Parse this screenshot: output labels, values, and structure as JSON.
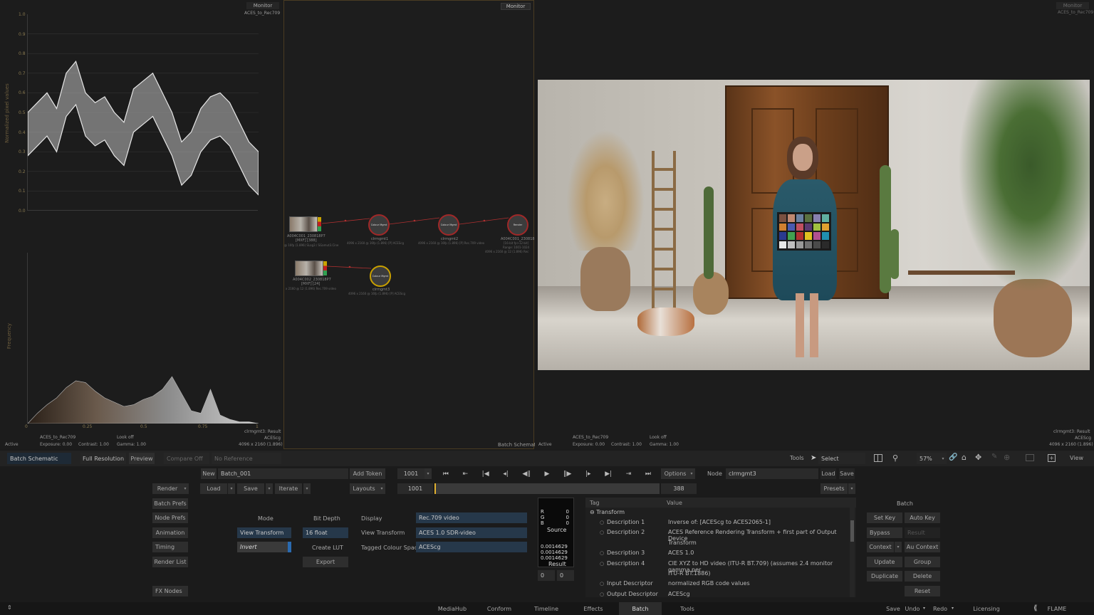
{
  "scopes": {
    "monitor_button": "Monitor",
    "view_transform": "ACES_to_Rec709",
    "waveform": {
      "ylabel": "Normalized pixel values",
      "yticks": [
        "1.0",
        "0.9",
        "0.8",
        "0.7",
        "0.6",
        "0.5",
        "0.4",
        "0.3",
        "0.2",
        "0.1",
        "0.0"
      ]
    },
    "histogram": {
      "ylabel": "Frequency",
      "xticks": [
        "0",
        "0.25",
        "0.5",
        "0.75",
        "1"
      ]
    },
    "footer": {
      "status": "Active",
      "transform": "ACES_to_Rec709",
      "look": "Look off",
      "exposure": "Exposure: 0.00",
      "contrast": "Contrast: 1.00",
      "gamma": "Gamma: 1.00",
      "node": "clrmgmt3: Result",
      "space": "ACEScg",
      "resolution": "4096 x 2160 (1.896)"
    }
  },
  "schematic": {
    "monitor_button": "Monitor",
    "footer_label": "Batch Schematic",
    "nodes": [
      {
        "name": "A004C001_230818P7",
        "sub1": "[MXF] [388]",
        "sub2": "@ 16fp (1.896) SLog3 / SGamut3.Cine"
      },
      {
        "name": "clrmgmt1",
        "sub": "4096 x 2160 @ 16fp (1.896) [P] ACEScg"
      },
      {
        "name": "clrmgmt2",
        "sub": "4096 x 2160 @ 16fp (1.896) [P] Rec.709 video"
      },
      {
        "name": "A004C001_230818P",
        "sub1": "[16-bit fp>12-bit]",
        "sub2": "Range: 1001-1024",
        "sub3": "4096 x 2160 @ 12 (1.896) Rec"
      },
      {
        "name": "A004C002_230818P7",
        "sub1": "[MXF] [24]",
        "sub2": "x 2160 @ 12 (1.896) Rec.709 video"
      },
      {
        "name": "clrmgmt3",
        "sub": "4096 x 2160 @ 16fp (1.896) [P] ACEScg"
      }
    ],
    "node_icon_labels": {
      "colour_mgmt": "Colour Mgmt",
      "render": "Render"
    }
  },
  "viewer": {
    "monitor_button": "Monitor",
    "view_transform": "ACES_to_Rec709",
    "footer": {
      "status": "Active",
      "transform": "ACES_to_Rec709",
      "look": "Look off",
      "exposure": "Exposure: 0.00",
      "contrast": "Contrast: 1.00",
      "gamma": "Gamma: 1.00",
      "node": "clrmgmt3: Result",
      "space": "ACEScg",
      "resolution": "4096 x 2160 (1.896)"
    }
  },
  "viewbar": {
    "batch_schematic": "Batch Schematic",
    "full_resolution": "Full Resolution",
    "preview": "Preview",
    "compare_off": "Compare Off",
    "no_reference": "No Reference",
    "tools": "Tools",
    "select": "Select",
    "zoom": "57%",
    "view": "View"
  },
  "batch_controls": {
    "new": "New",
    "batch_name": "Batch_001",
    "add_token": "Add Token",
    "frame": "1001",
    "options": "Options",
    "node_label": "Node",
    "node_name": "clrmgmt3",
    "load": "Load",
    "save": "Save",
    "render": "Render",
    "load2": "Load",
    "save2": "Save",
    "iterate": "Iterate",
    "layouts": "Layouts",
    "range_start": "1001",
    "range_end": "388",
    "presets": "Presets",
    "batch_prefs": "Batch Prefs",
    "node_prefs": "Node Prefs",
    "animation": "Animation",
    "timing": "Timing",
    "render_list": "Render List",
    "fx_nodes": "FX Nodes"
  },
  "colour_mgmt": {
    "mode_label": "Mode",
    "mode_value": "View Transform",
    "invert": "Invert",
    "bit_depth_label": "Bit Depth",
    "bit_depth_value": "16 float",
    "create_lut": "Create LUT",
    "export": "Export",
    "display_label": "Display",
    "display_value": "Rec.709 video",
    "view_transform_label": "View Transform",
    "view_transform_value": "ACES 1.0 SDR-video",
    "tagged_label": "Tagged Colour Space",
    "tagged_value": "ACEScg"
  },
  "picker": {
    "r": "R",
    "g": "G",
    "b": "B",
    "src_r": "0",
    "src_g": "0",
    "src_b": "0",
    "source": "Source",
    "res_r": "0.0014629",
    "res_g": "0.0014629",
    "res_b": "0.0014629",
    "result": "Result",
    "x": "0",
    "y": "0"
  },
  "metadata": {
    "col_tag": "Tag",
    "col_value": "Value",
    "transform": "Transform",
    "rows": [
      {
        "tag": "Description 1",
        "value": "Inverse of: [ACEScg to ACES2065-1]"
      },
      {
        "tag": "Description 2",
        "value": "ACES Reference Rendering Transform + first part of Output Device"
      },
      {
        "tag": "",
        "value": "Transform"
      },
      {
        "tag": "Description 3",
        "value": "ACES 1.0"
      },
      {
        "tag": "Description 4",
        "value": "CIE XYZ to HD video (ITU-R BT.709) (assumes 2.4 monitor gamma per"
      },
      {
        "tag": "",
        "value": "ITU-R BT.1886)"
      },
      {
        "tag": "Input Descriptor",
        "value": "normalized RGB code values"
      },
      {
        "tag": "Output Descriptor",
        "value": "ACEScg"
      }
    ]
  },
  "batch_side": {
    "title": "Batch",
    "set_key": "Set Key",
    "auto_key": "Auto Key",
    "bypass": "Bypass",
    "result": "Result",
    "context": "Context",
    "au_context": "Au Context",
    "update": "Update",
    "group": "Group",
    "duplicate": "Duplicate",
    "delete": "Delete",
    "reset": "Reset"
  },
  "bottom_tabs": [
    "MediaHub",
    "Conform",
    "Timeline",
    "Effects",
    "Batch",
    "Tools"
  ],
  "bottom_right": {
    "save": "Save",
    "undo": "Undo",
    "redo": "Redo",
    "licensing": "Licensing",
    "app": "FLAME"
  },
  "waveform_series": [
    0.5,
    0.55,
    0.6,
    0.52,
    0.7,
    0.76,
    0.6,
    0.55,
    0.58,
    0.5,
    0.45,
    0.62,
    0.66,
    0.7,
    0.6,
    0.5,
    0.35,
    0.4,
    0.52,
    0.58,
    0.6,
    0.55,
    0.45,
    0.35,
    0.3
  ],
  "histogram_series": [
    0.0,
    0.12,
    0.22,
    0.3,
    0.42,
    0.5,
    0.48,
    0.38,
    0.3,
    0.25,
    0.2,
    0.22,
    0.28,
    0.32,
    0.4,
    0.55,
    0.35,
    0.15,
    0.12,
    0.4,
    0.1,
    0.05,
    0.02,
    0.02,
    0.0
  ]
}
